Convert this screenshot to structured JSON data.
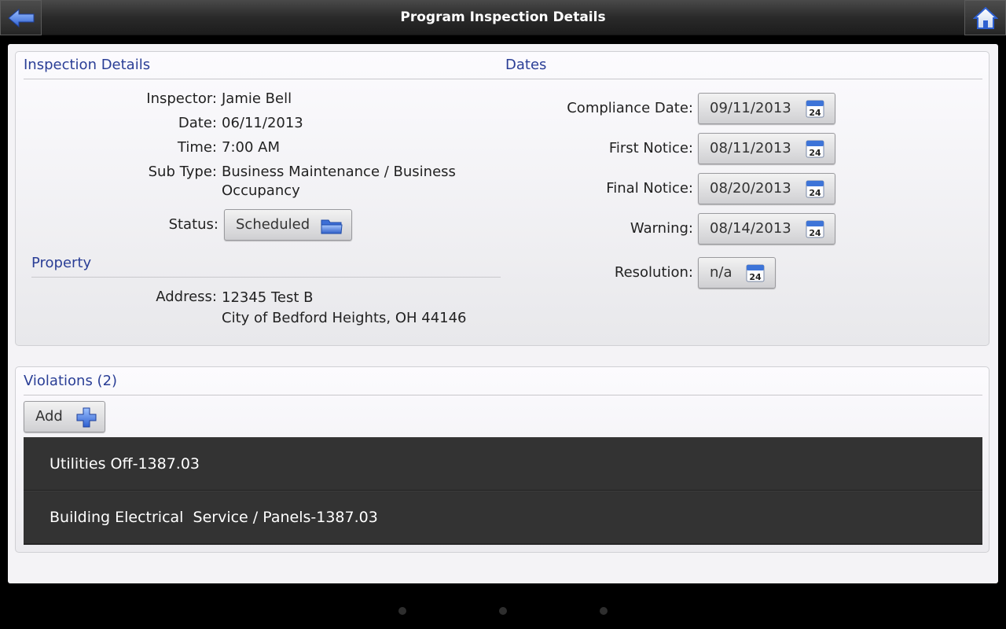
{
  "header": {
    "title": "Program Inspection Details",
    "back_icon": "back-arrow-icon",
    "home_icon": "home-icon"
  },
  "inspection": {
    "section_title": "Inspection Details",
    "inspector_label": "Inspector:",
    "inspector_value": "Jamie Bell",
    "date_label": "Date:",
    "date_value": "06/11/2013",
    "time_label": "Time:",
    "time_value": "7:00 AM",
    "subtype_label": "Sub Type:",
    "subtype_value_line1": "Business Maintenance / Business",
    "subtype_value_line2": "Occupancy",
    "status_label": "Status:",
    "status_value": "Scheduled"
  },
  "property": {
    "section_title": "Property",
    "address_label": "Address:",
    "address_line1": "12345 Test B",
    "address_line2": "City of Bedford Heights, OH 44146"
  },
  "dates": {
    "section_title": "Dates",
    "compliance_label": "Compliance Date:",
    "compliance_value": "09/11/2013",
    "first_notice_label": "First Notice:",
    "first_notice_value": "08/11/2013",
    "final_notice_label": "Final Notice:",
    "final_notice_value": "08/20/2013",
    "warning_label": "Warning:",
    "warning_value": "08/14/2013",
    "resolution_label": "Resolution:",
    "resolution_value": "n/a",
    "calendar_day": "24"
  },
  "violations": {
    "section_title": "Violations (2)",
    "add_label": "Add",
    "items": [
      "Utilities Off-1387.03",
      "Building Electrical  Service / Panels-1387.03"
    ]
  },
  "colors": {
    "accent": "#2a3e96",
    "titlebar": "#2a2a2a",
    "list_bg": "#333333"
  }
}
